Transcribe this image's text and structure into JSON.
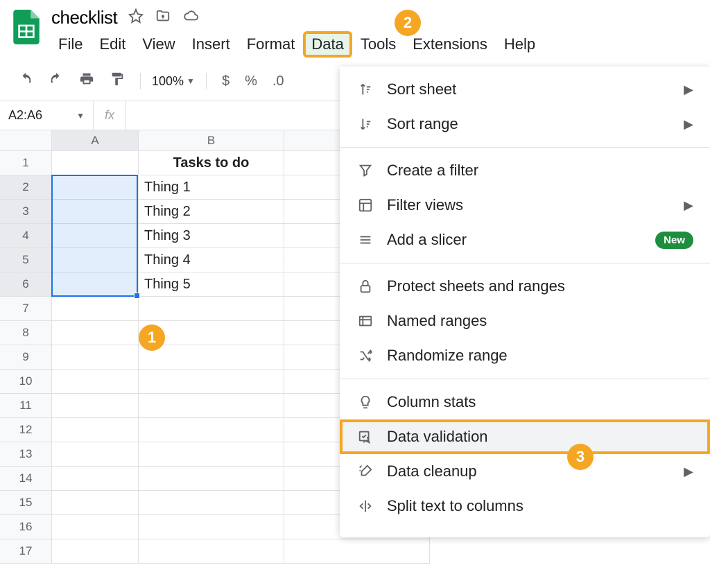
{
  "doc": {
    "title": "checklist"
  },
  "menu": {
    "items": [
      "File",
      "Edit",
      "View",
      "Insert",
      "Format",
      "Data",
      "Tools",
      "Extensions",
      "Help"
    ],
    "active": "Data"
  },
  "toolbar": {
    "zoom": "100%",
    "currency": "$",
    "percent": "%",
    "decimal": ".0"
  },
  "namebox": {
    "value": "A2:A6"
  },
  "fx": {
    "label": "fx"
  },
  "columns": [
    "A",
    "B"
  ],
  "rows": [
    1,
    2,
    3,
    4,
    5,
    6,
    7,
    8,
    9,
    10,
    11,
    12,
    13,
    14,
    15,
    16,
    17
  ],
  "sheet": {
    "header": "Tasks to do",
    "tasks": [
      "Thing 1",
      "Thing 2",
      "Thing 3",
      "Thing 4",
      "Thing 5"
    ]
  },
  "dropdown": {
    "items": [
      {
        "icon": "sort-sheet",
        "label": "Sort sheet",
        "submenu": true
      },
      {
        "icon": "sort-range",
        "label": "Sort range",
        "submenu": true
      },
      {
        "sep": true
      },
      {
        "icon": "filter",
        "label": "Create a filter"
      },
      {
        "icon": "filter-views",
        "label": "Filter views",
        "submenu": true
      },
      {
        "icon": "slicer",
        "label": "Add a slicer",
        "new": true
      },
      {
        "sep": true
      },
      {
        "icon": "protect",
        "label": "Protect sheets and ranges"
      },
      {
        "icon": "named-ranges",
        "label": "Named ranges"
      },
      {
        "icon": "randomize",
        "label": "Randomize range"
      },
      {
        "sep": true
      },
      {
        "icon": "column-stats",
        "label": "Column stats"
      },
      {
        "icon": "validation",
        "label": "Data validation",
        "highlight": true
      },
      {
        "icon": "cleanup",
        "label": "Data cleanup",
        "submenu": true
      },
      {
        "icon": "split",
        "label": "Split text to columns"
      }
    ],
    "new_label": "New"
  },
  "steps": {
    "s1": "1",
    "s2": "2",
    "s3": "3"
  }
}
